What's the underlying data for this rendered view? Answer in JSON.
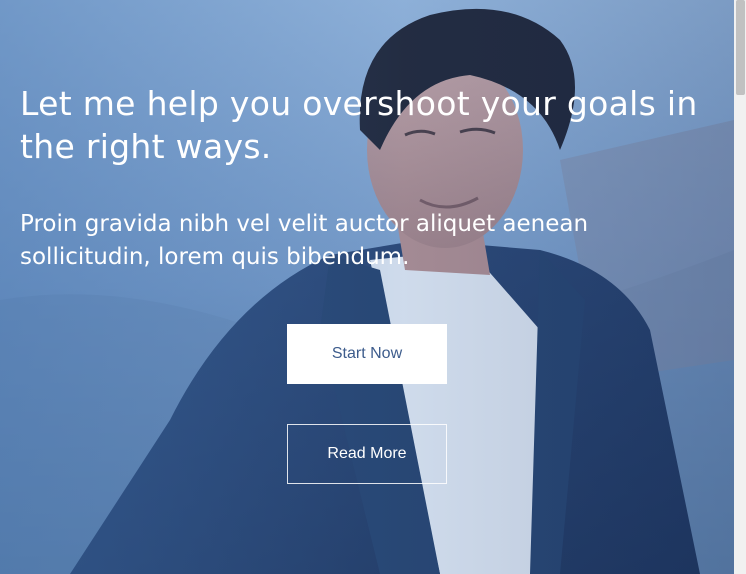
{
  "hero": {
    "headline": "Let me help you overshoot your goals in the right ways.",
    "subtext": "Proin gravida nibh vel velit auctor aliquet aenean sollicitudin, lorem quis bibendum.",
    "primary_button": "Start Now",
    "secondary_button": "Read More",
    "image_description": "man-in-navy-blazer-smiling"
  },
  "colors": {
    "overlay_tint": "#3e6eaa",
    "primary_button_bg": "#ffffff",
    "primary_button_text": "#3d5c8c",
    "secondary_button_text": "#ffffff"
  }
}
